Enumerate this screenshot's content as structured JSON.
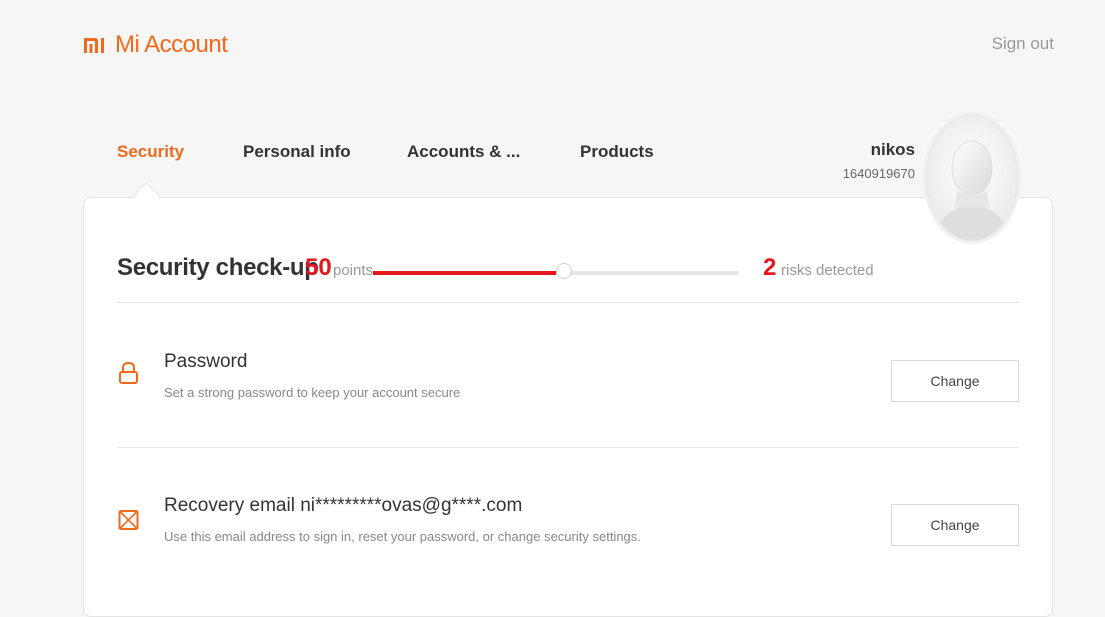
{
  "header": {
    "logo_mark": "mi-logo",
    "app_title": "Mi Account",
    "signout_label": "Sign out"
  },
  "tabs": [
    {
      "label": "Security",
      "active": true
    },
    {
      "label": "Personal info",
      "active": false
    },
    {
      "label": "Accounts & ...",
      "active": false
    },
    {
      "label": "Products",
      "active": false
    }
  ],
  "user": {
    "name": "nikos",
    "id": "1640919670",
    "avatar": "default-avatar-silhouette"
  },
  "security_checkup": {
    "title": "Security check-up",
    "points": "50",
    "points_label": "points",
    "score_percent": 50,
    "risks": "2",
    "risks_label": "risks detected"
  },
  "items": [
    {
      "icon": "lock-icon",
      "title": "Password",
      "description": "Set a strong password to keep your account secure",
      "button": "Change"
    },
    {
      "icon": "envelope-icon",
      "title": "Recovery email ni*********ovas@g****.com",
      "description": "Use this email address to sign in, reset your password, or change security settings.",
      "button": "Change"
    }
  ],
  "colors": {
    "brand": "#f06a1c",
    "risk": "#e4161e",
    "text": "#333333",
    "muted": "#999999"
  }
}
